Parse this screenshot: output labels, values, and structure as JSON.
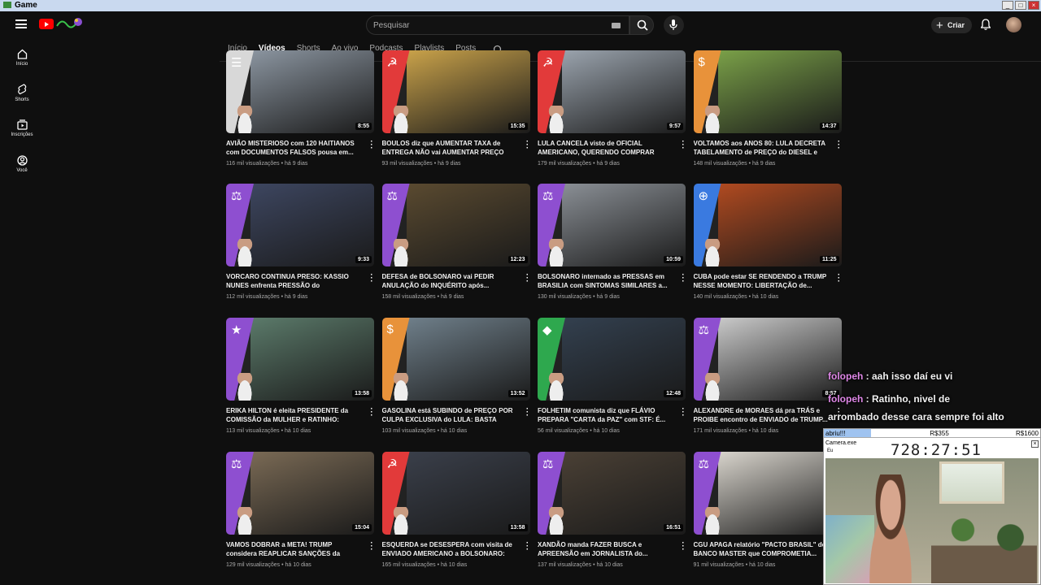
{
  "window": {
    "title": "Game"
  },
  "header": {
    "search_placeholder": "Pesquisar",
    "create_label": "Criar"
  },
  "sidebar": {
    "items": [
      {
        "label": "Início",
        "icon": "home-icon"
      },
      {
        "label": "Shorts",
        "icon": "shorts-icon"
      },
      {
        "label": "Inscrições",
        "icon": "subscriptions-icon"
      },
      {
        "label": "Você",
        "icon": "you-icon"
      }
    ]
  },
  "tabs": [
    {
      "label": "Início",
      "active": false
    },
    {
      "label": "Vídeos",
      "active": true
    },
    {
      "label": "Shorts",
      "active": false
    },
    {
      "label": "Ao vivo",
      "active": false
    },
    {
      "label": "Podcasts",
      "active": false
    },
    {
      "label": "Playlists",
      "active": false
    },
    {
      "label": "Posts",
      "active": false
    }
  ],
  "videos": [
    {
      "title": "AVIÃO MISTERIOSO com 120 HAITIANOS com DOCUMENTOS FALSOS pousa em...",
      "views": "116 mil visualizações",
      "age": "há 9 dias",
      "duration": "8:55",
      "theme": "plain",
      "band": "#d8d8d8",
      "bg": "#8b95a0"
    },
    {
      "title": "BOULOS diz que AUMENTAR TAXA de ENTREGA NÃO vai AUMENTAR PREÇO par...",
      "views": "93 mil visualizações",
      "age": "há 9 dias",
      "duration": "15:35",
      "theme": "hammer-sickle",
      "band": "#e23a3a",
      "bg": "#c9a24a"
    },
    {
      "title": "LULA CANCELA visto de OFICIAL AMERICANO, QUERENDO COMPRAR BRIG...",
      "views": "179 mil visualizações",
      "age": "há 9 dias",
      "duration": "9:57",
      "theme": "hammer-sickle",
      "band": "#e23a3a",
      "bg": "#9aa3ad"
    },
    {
      "title": "VOLTAMOS aos ANOS 80: LULA DECRETA TABELAMENTO de PREÇO do DIESEL e RS...",
      "views": "148 mil visualizações",
      "age": "há 9 dias",
      "duration": "14:37",
      "theme": "dollar",
      "band": "#e8923a",
      "bg": "#7aa048"
    },
    {
      "title": "VORCARO CONTINUA PRESO: KASSIO NUNES enfrenta PRESSÃO do CONGRESSO...",
      "views": "112 mil visualizações",
      "age": "há 9 dias",
      "duration": "9:33",
      "theme": "scales",
      "band": "#8e4fd0",
      "bg": "#3d4660"
    },
    {
      "title": "DEFESA de BOLSONARO vai PEDIR ANULAÇÃO do INQUÉRITO após...",
      "views": "158 mil visualizações",
      "age": "há 9 dias",
      "duration": "12:23",
      "theme": "scales",
      "band": "#8e4fd0",
      "bg": "#5a4a30"
    },
    {
      "title": "BOLSONARO internado as PRESSAS em BRASILIA com SINTOMAS SIMILARES a...",
      "views": "130 mil visualizações",
      "age": "há 9 dias",
      "duration": "10:59",
      "theme": "scales",
      "band": "#8e4fd0",
      "bg": "#8a8f95"
    },
    {
      "title": "CUBA pode estar SE RENDENDO a TRUMP NESSE MOMENTO: LIBERTAÇÃO de...",
      "views": "140 mil visualizações",
      "age": "há 10 dias",
      "duration": "11:25",
      "theme": "globe",
      "band": "#3a7ae0",
      "bg": "#b04a20"
    },
    {
      "title": "ERIKA HILTON é eleita PRESIDENTE da COMISSÃO da MULHER e RATINHO: \"NÃO...",
      "views": "113 mil visualizações",
      "age": "há 10 dias",
      "duration": "13:58",
      "theme": "star",
      "band": "#8e4fd0",
      "bg": "#5b7a6a"
    },
    {
      "title": "GASOLINA está SUBINDO de PREÇO POR CULPA EXCLUSIVA do LULA: BASTA dimin...",
      "views": "103 mil visualizações",
      "age": "há 10 dias",
      "duration": "13:52",
      "theme": "dollar",
      "band": "#e8923a",
      "bg": "#6f7f8a"
    },
    {
      "title": "FOLHETIM comunista diz que FLÁVIO PREPARA \"CARTA da PAZ\" com STF: É...",
      "views": "56 mil visualizações",
      "age": "há 10 dias",
      "duration": "12:48",
      "theme": "flag",
      "band": "#2ea84e",
      "bg": "#33404f"
    },
    {
      "title": "ALEXANDRE de MORAES dá pra TRÁS e PROIBE encontro de ENVIADO de TRUMP...",
      "views": "171 mil visualizações",
      "age": "há 10 dias",
      "duration": "8:57",
      "theme": "scales",
      "band": "#8e4fd0",
      "bg": "#c9c9c9"
    },
    {
      "title": "VAMOS DOBRAR a META! TRUMP considera REAPLICAR SANÇÕES da MAGNITSKY em...",
      "views": "129 mil visualizações",
      "age": "há 10 dias",
      "duration": "15:04",
      "theme": "scales",
      "band": "#8e4fd0",
      "bg": "#7a6a55"
    },
    {
      "title": "ESQUERDA se DESESPERA com visita de ENVIADO AMERICANO a BOLSONARO: \"EL...",
      "views": "165 mil visualizações",
      "age": "há 10 dias",
      "duration": "13:58",
      "theme": "hammer-sickle",
      "band": "#e23a3a",
      "bg": "#3a3f4a"
    },
    {
      "title": "XANDÃO manda FAZER BUSCA e APREENSÃO em JORNALISTA do...",
      "views": "137 mil visualizações",
      "age": "há 10 dias",
      "duration": "16:51",
      "theme": "scales",
      "band": "#8e4fd0",
      "bg": "#4a4035"
    },
    {
      "title": "CGU APAGA relatório \"PACTO BRASIL\" do BANCO MASTER que COMPROMETIA...",
      "views": "91 mil visualizações",
      "age": "há 10 dias",
      "duration": "",
      "theme": "scales",
      "band": "#8e4fd0",
      "bg": "#d8d4cc"
    }
  ],
  "chat": [
    {
      "user": "folopeh",
      "text": ": aah isso daí eu vi"
    },
    {
      "user": "folopeh",
      "text": ": Ratinho, nivel de"
    },
    {
      "user": "",
      "text": "arrombado desse cara sempre foi alto"
    }
  ],
  "overlay": {
    "goal_label": "abriu!!!",
    "milestone1": "R$355",
    "milestone2": "R$1600",
    "camera_title": "Camera.exe",
    "camera_sub": "Eu",
    "timer": "728:27:51"
  }
}
